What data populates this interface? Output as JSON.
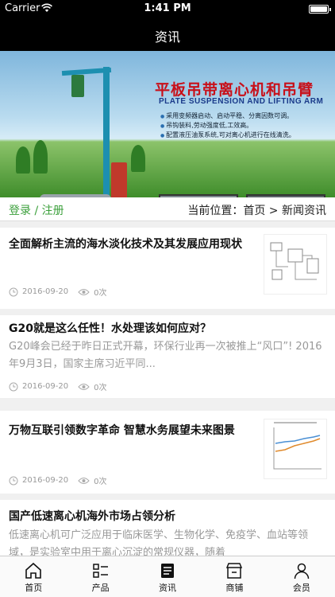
{
  "status_bar": {
    "carrier": "Carrier",
    "time": "1:41 PM"
  },
  "navbar": {
    "title": "资讯"
  },
  "banner": {
    "headline": "平板吊带离心机和吊臂",
    "subtitle": "PLATE SUSPENSION AND LIFTING ARM",
    "features": [
      "采用变频器启动、启动平稳、分离因数可调。",
      "吊钩装料,劳动强度低,工效高。",
      "配置液压油泵系统,可对离心机进行在线清洗。"
    ]
  },
  "login_bar": {
    "auth_label": "登录 / 注册",
    "breadcrumb": "当前位置：首页 > 新闻资讯"
  },
  "news": [
    {
      "title": "全面解析主流的海水淡化技术及其发展应用现状",
      "date": "2016-09-20",
      "views": "0次"
    },
    {
      "title": "G20就是这么任性！水处理该如何应对？",
      "summary": "G20峰会已经于昨日正式开幕，环保行业再一次被推上“风口”!   2016年9月3日，国家主席习近平同...",
      "date": "2016-09-20",
      "views": "0次"
    },
    {
      "title": "万物互联引领数字革命 智慧水务展望未来图景",
      "date": "2016-09-20",
      "views": "0次"
    },
    {
      "title": "国产低速离心机海外市场占领分析",
      "summary": "低速离心机可广泛应用于临床医学、生物化学、免疫学、血站等领域，是实验室中用于离心沉淀的常规仪器，随着"
    }
  ],
  "tabbar": [
    {
      "label": "首页",
      "icon": "home-icon"
    },
    {
      "label": "产品",
      "icon": "list-icon"
    },
    {
      "label": "资讯",
      "icon": "news-icon"
    },
    {
      "label": "商铺",
      "icon": "store-icon"
    },
    {
      "label": "会员",
      "icon": "user-icon"
    }
  ]
}
